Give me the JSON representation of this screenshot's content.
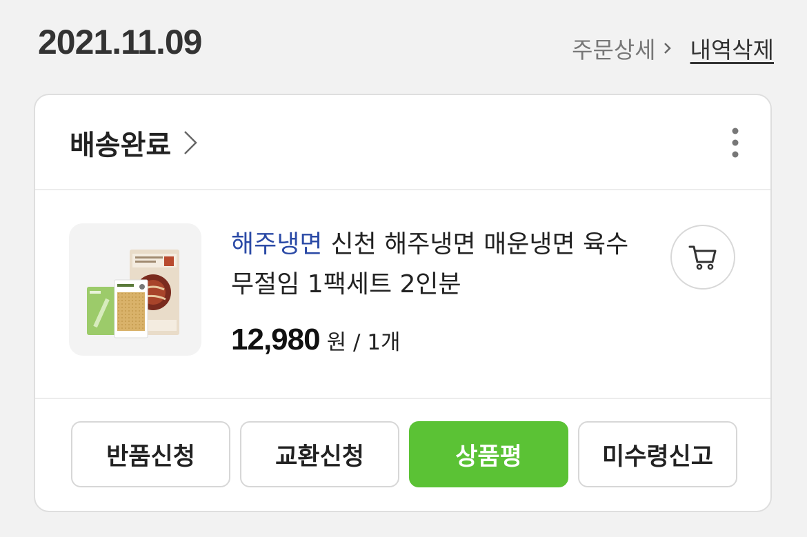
{
  "header": {
    "date": "2021.11.09",
    "order_detail_label": "주문상세",
    "delete_history_label": "내역삭제"
  },
  "card": {
    "status_label": "배송완료",
    "product": {
      "brand": "해주냉면",
      "name": "신천 해주냉면 매운냉면 육수 무절임 1팩세트 2인분",
      "price": "12,980",
      "price_unit": "원 / 1개",
      "image_icon": "product-package-image"
    },
    "actions": [
      {
        "label": "반품신청"
      },
      {
        "label": "교환신청"
      },
      {
        "label": "상품평"
      },
      {
        "label": "미수령신고"
      }
    ]
  },
  "colors": {
    "brand_text": "#2b4aa6",
    "primary_button": "#5bc235",
    "background": "#f2f2f2"
  }
}
